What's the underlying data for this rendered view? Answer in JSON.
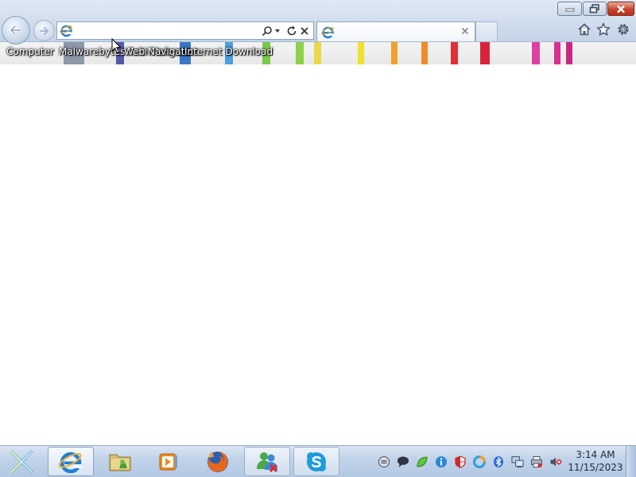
{
  "browser": {
    "address_value": "",
    "address_placeholder": "",
    "tab_title": "",
    "icons": [
      "back-arrow-icon",
      "forward-arrow-icon",
      "ie-logo-icon",
      "search-icon",
      "dropdown-icon",
      "refresh-icon",
      "stop-icon",
      "home-icon",
      "favorites-star-icon",
      "gear-icon"
    ],
    "window_buttons": [
      "minimize",
      "restore",
      "close"
    ]
  },
  "desktop_icons": [
    {
      "label": "Computer"
    },
    {
      "label": "Malwarebytes Anti-Malware"
    },
    {
      "label": "Web Navigation"
    },
    {
      "label": "Internet Download"
    }
  ],
  "taskbar": {
    "start_icon": "start-orb-icon",
    "apps": [
      {
        "name": "internet-explorer",
        "active": true
      },
      {
        "name": "file-explorer",
        "active": false
      },
      {
        "name": "media-player",
        "active": false
      },
      {
        "name": "firefox",
        "active": false
      },
      {
        "name": "messenger",
        "active": false
      },
      {
        "name": "skype",
        "active": false
      }
    ],
    "tray_icons": [
      "chat-bubble-icon",
      "speech-icon",
      "leaf-icon",
      "info-icon",
      "shield-icon",
      "circle-app-icon",
      "bluetooth-icon",
      "network-icon",
      "printer-icon",
      "volume-muted-icon"
    ],
    "clock_time": "3:14 AM",
    "clock_date": "11/15/2023"
  },
  "colors": {
    "close_red": "#c9432b",
    "ie_blue": "#1c7fd6",
    "taskbar": "#c1d3e9"
  }
}
